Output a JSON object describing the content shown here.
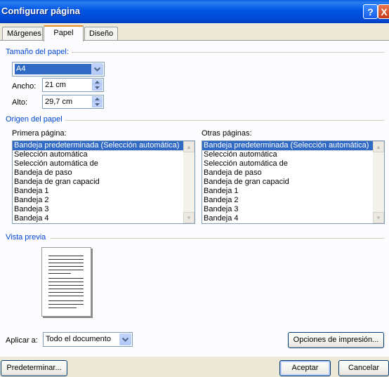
{
  "window": {
    "title": "Configurar página"
  },
  "title_buttons": {
    "help": "?",
    "close": "X"
  },
  "tabs": [
    {
      "label": "Márgenes",
      "active": false
    },
    {
      "label": "Papel",
      "active": true
    },
    {
      "label": "Diseño",
      "active": false
    }
  ],
  "paper_size": {
    "section_label": "Tamaño del papel:",
    "selected": "A4",
    "width_label": "Ancho:",
    "width_value": "21 cm",
    "height_label": "Alto:",
    "height_value": "29,7 cm"
  },
  "paper_source": {
    "section_label": "Origen del papel",
    "first_page_label": "Primera página:",
    "other_pages_label": "Otras páginas:",
    "first_page_items": [
      "Bandeja predeterminada (Selección automática)",
      "Selección automática",
      "Selección automática de",
      "Bandeja de paso",
      "Bandeja de gran capacid",
      "Bandeja 1",
      "Bandeja 2",
      "Bandeja 3",
      "Bandeja 4"
    ],
    "other_pages_items": [
      "Bandeja predeterminada (Selección automática)",
      "Selección automática",
      "Selección automática de",
      "Bandeja de paso",
      "Bandeja de gran capacid",
      "Bandeja 1",
      "Bandeja 2",
      "Bandeja 3",
      "Bandeja 4"
    ],
    "selected_index": 0
  },
  "preview": {
    "section_label": "Vista previa"
  },
  "apply": {
    "label": "Aplicar a:",
    "selected": "Todo el documento"
  },
  "buttons": {
    "print_options": "Opciones de impresión...",
    "default": "Predeterminar...",
    "ok": "Aceptar",
    "cancel": "Cancelar"
  },
  "colors": {
    "accent": "#0046d5",
    "selection": "#316ac5",
    "title_bar": "#0055e5"
  },
  "icons": [
    "help-icon",
    "close-icon",
    "chevron-down-icon",
    "spin-up-icon",
    "spin-down-icon",
    "scroll-up-icon",
    "scroll-down-icon",
    "page-preview-icon"
  ]
}
